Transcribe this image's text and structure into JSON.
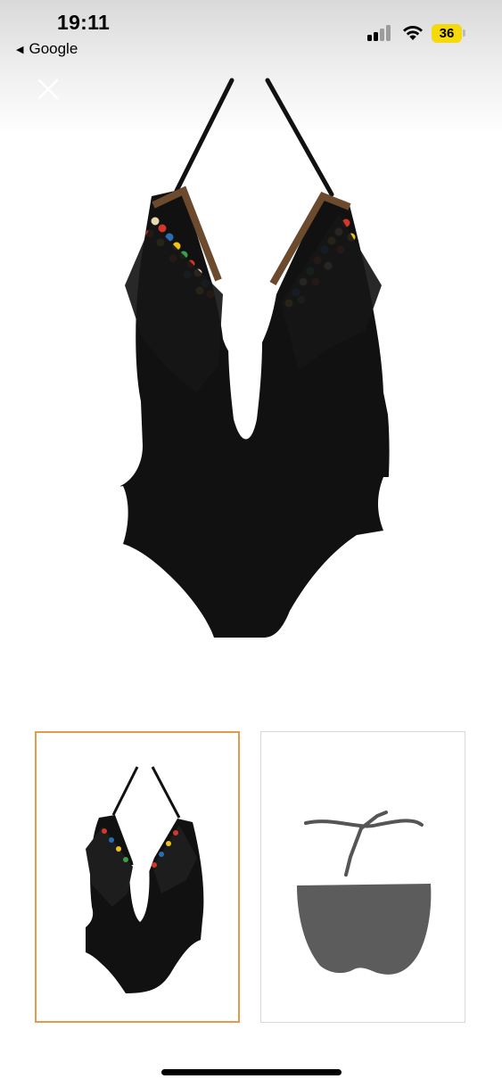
{
  "status_bar": {
    "time": "19:11",
    "back_label": "Google",
    "battery_level": "36",
    "battery_color": "#f5d90a",
    "signal_bars_active": 2,
    "signal_bars_total": 4
  },
  "viewer": {
    "close_icon": "close-icon",
    "main_image": "black-swimsuit-front",
    "selected_thumbnail": 0,
    "thumbnails": [
      {
        "image": "black-swimsuit-front"
      },
      {
        "image": "grey-bikini-bottom-with-tie"
      }
    ],
    "selected_border_color": "#e39a4a"
  }
}
